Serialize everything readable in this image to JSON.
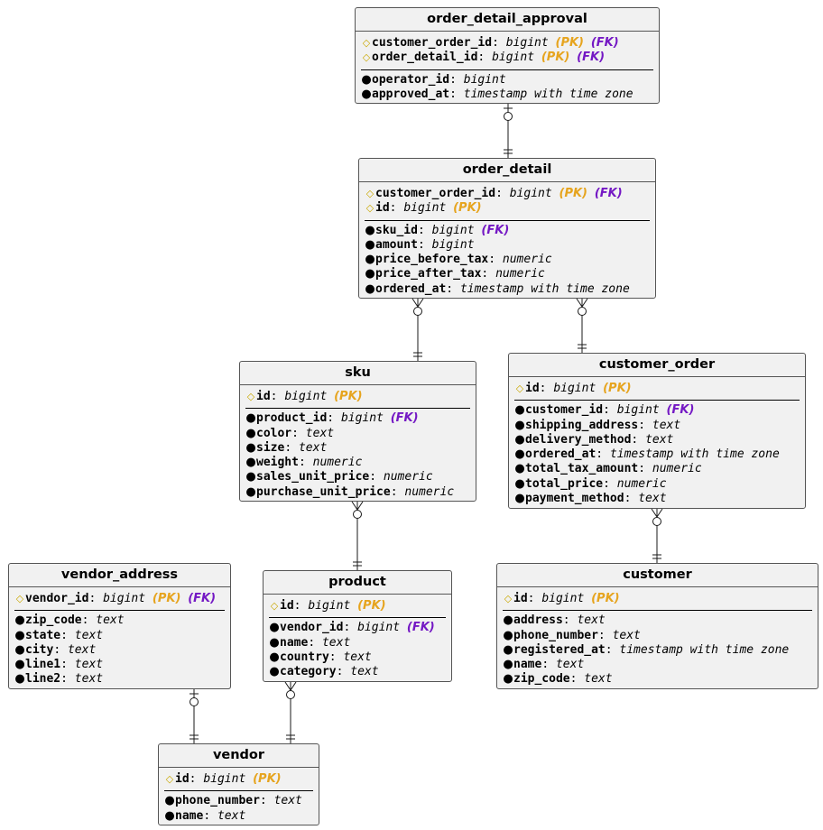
{
  "entities": [
    {
      "id": "order_detail_approval",
      "title": "order_detail_approval",
      "keys": [
        {
          "name": "customer_order_id",
          "type": "bigint",
          "pk": "(PK)",
          "fk": "(FK)"
        },
        {
          "name": "order_detail_id",
          "type": "bigint",
          "pk": "(PK)",
          "fk": "(FK)"
        }
      ],
      "attrs": [
        {
          "name": "operator_id",
          "type": "bigint"
        },
        {
          "name": "approved_at",
          "type": "timestamp with time zone"
        }
      ]
    },
    {
      "id": "order_detail",
      "title": "order_detail",
      "keys": [
        {
          "name": "customer_order_id",
          "type": "bigint",
          "pk": "(PK)",
          "fk": "(FK)"
        },
        {
          "name": "id",
          "type": "bigint",
          "pk": "(PK)"
        }
      ],
      "attrs": [
        {
          "name": "sku_id",
          "type": "bigint",
          "fk": "(FK)"
        },
        {
          "name": "amount",
          "type": "bigint"
        },
        {
          "name": "price_before_tax",
          "type": "numeric"
        },
        {
          "name": "price_after_tax",
          "type": "numeric"
        },
        {
          "name": "ordered_at",
          "type": "timestamp with time zone"
        }
      ]
    },
    {
      "id": "sku",
      "title": "sku",
      "keys": [
        {
          "name": "id",
          "type": "bigint",
          "pk": "(PK)"
        }
      ],
      "attrs": [
        {
          "name": "product_id",
          "type": "bigint",
          "fk": "(FK)"
        },
        {
          "name": "color",
          "type": "text"
        },
        {
          "name": "size",
          "type": "text"
        },
        {
          "name": "weight",
          "type": "numeric"
        },
        {
          "name": "sales_unit_price",
          "type": "numeric"
        },
        {
          "name": "purchase_unit_price",
          "type": "numeric"
        }
      ]
    },
    {
      "id": "customer_order",
      "title": "customer_order",
      "keys": [
        {
          "name": "id",
          "type": "bigint",
          "pk": "(PK)"
        }
      ],
      "attrs": [
        {
          "name": "customer_id",
          "type": "bigint",
          "fk": "(FK)"
        },
        {
          "name": "shipping_address",
          "type": "text"
        },
        {
          "name": "delivery_method",
          "type": "text"
        },
        {
          "name": "ordered_at",
          "type": "timestamp with time zone"
        },
        {
          "name": "total_tax_amount",
          "type": "numeric"
        },
        {
          "name": "total_price",
          "type": "numeric"
        },
        {
          "name": "payment_method",
          "type": "text"
        }
      ]
    },
    {
      "id": "vendor_address",
      "title": "vendor_address",
      "keys": [
        {
          "name": "vendor_id",
          "type": "bigint",
          "pk": "(PK)",
          "fk": "(FK)"
        }
      ],
      "attrs": [
        {
          "name": "zip_code",
          "type": "text"
        },
        {
          "name": "state",
          "type": "text"
        },
        {
          "name": "city",
          "type": "text"
        },
        {
          "name": "line1",
          "type": "text"
        },
        {
          "name": "line2",
          "type": "text"
        }
      ]
    },
    {
      "id": "product",
      "title": "product",
      "keys": [
        {
          "name": "id",
          "type": "bigint",
          "pk": "(PK)"
        }
      ],
      "attrs": [
        {
          "name": "vendor_id",
          "type": "bigint",
          "fk": "(FK)"
        },
        {
          "name": "name",
          "type": "text"
        },
        {
          "name": "country",
          "type": "text"
        },
        {
          "name": "category",
          "type": "text"
        }
      ]
    },
    {
      "id": "customer",
      "title": "customer",
      "keys": [
        {
          "name": "id",
          "type": "bigint",
          "pk": "(PK)"
        }
      ],
      "attrs": [
        {
          "name": "address",
          "type": "text"
        },
        {
          "name": "phone_number",
          "type": "text"
        },
        {
          "name": "registered_at",
          "type": "timestamp with time zone"
        },
        {
          "name": "name",
          "type": "text"
        },
        {
          "name": "zip_code",
          "type": "text"
        }
      ]
    },
    {
      "id": "vendor",
      "title": "vendor",
      "keys": [
        {
          "name": "id",
          "type": "bigint",
          "pk": "(PK)"
        }
      ],
      "attrs": [
        {
          "name": "phone_number",
          "type": "text"
        },
        {
          "name": "name",
          "type": "text"
        }
      ]
    }
  ],
  "relationships": [
    {
      "from": "order_detail_approval",
      "to": "order_detail",
      "from_cardinality": "zero-or-one",
      "to_cardinality": "exactly-one"
    },
    {
      "from": "order_detail",
      "to": "sku",
      "from_cardinality": "zero-or-many",
      "to_cardinality": "exactly-one"
    },
    {
      "from": "order_detail",
      "to": "customer_order",
      "from_cardinality": "zero-or-many",
      "to_cardinality": "exactly-one"
    },
    {
      "from": "sku",
      "to": "product",
      "from_cardinality": "zero-or-many",
      "to_cardinality": "exactly-one"
    },
    {
      "from": "customer_order",
      "to": "customer",
      "from_cardinality": "zero-or-many",
      "to_cardinality": "exactly-one"
    },
    {
      "from": "vendor_address",
      "to": "vendor",
      "from_cardinality": "zero-or-one",
      "to_cardinality": "exactly-one"
    },
    {
      "from": "product",
      "to": "vendor",
      "from_cardinality": "zero-or-many",
      "to_cardinality": "exactly-one"
    }
  ],
  "colors": {
    "pk": "#e6a41e",
    "fk": "#7418c4",
    "key_icon": "#c9a800",
    "box_fill": "#f1f1f1",
    "box_border": "#555555",
    "line": "#181818"
  },
  "icons": {
    "key": "diamond-key-icon",
    "attribute": "bullet-icon"
  }
}
